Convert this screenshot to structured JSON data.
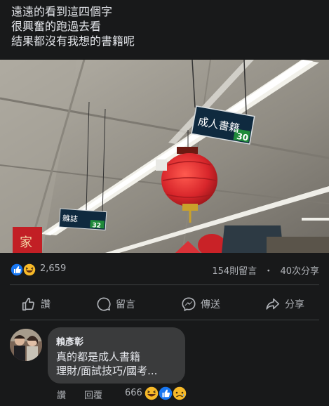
{
  "post": {
    "caption_lines": [
      "遠遠的看到這四個字",
      "很興奮的跑過去看",
      "結果都沒有我想的書籍呢"
    ]
  },
  "photo": {
    "signs": [
      {
        "text": "成人書籍",
        "number": "30"
      },
      {
        "text": "雜誌",
        "number": "32"
      }
    ],
    "banner_char": "家"
  },
  "stats": {
    "reaction_count": "2,659",
    "comments": "154則留言",
    "separator": "・",
    "shares": "40次分享",
    "reaction_icons": [
      "like-icon",
      "haha-icon"
    ]
  },
  "actions": {
    "like": "讚",
    "comment": "留言",
    "send": "傳送",
    "share": "分享"
  },
  "comment": {
    "author": "賴彥彰",
    "text_lines": [
      "真的都是成人書籍",
      "理財/面試技巧/國考..."
    ],
    "like_label": "讚",
    "reply_label": "回覆",
    "reaction_count": "666",
    "reaction_icons": [
      "haha-icon",
      "like-icon",
      "sad-icon"
    ]
  },
  "colors": {
    "background": "#18191a",
    "bubble": "#3a3b3c",
    "text_primary": "#e4e6eb",
    "text_secondary": "#b0b3b8",
    "like_blue": "#1877f2",
    "emoji_yellow": "#f7b928",
    "sign_green": "#1f8a3a",
    "lantern_red": "#d8262b"
  }
}
